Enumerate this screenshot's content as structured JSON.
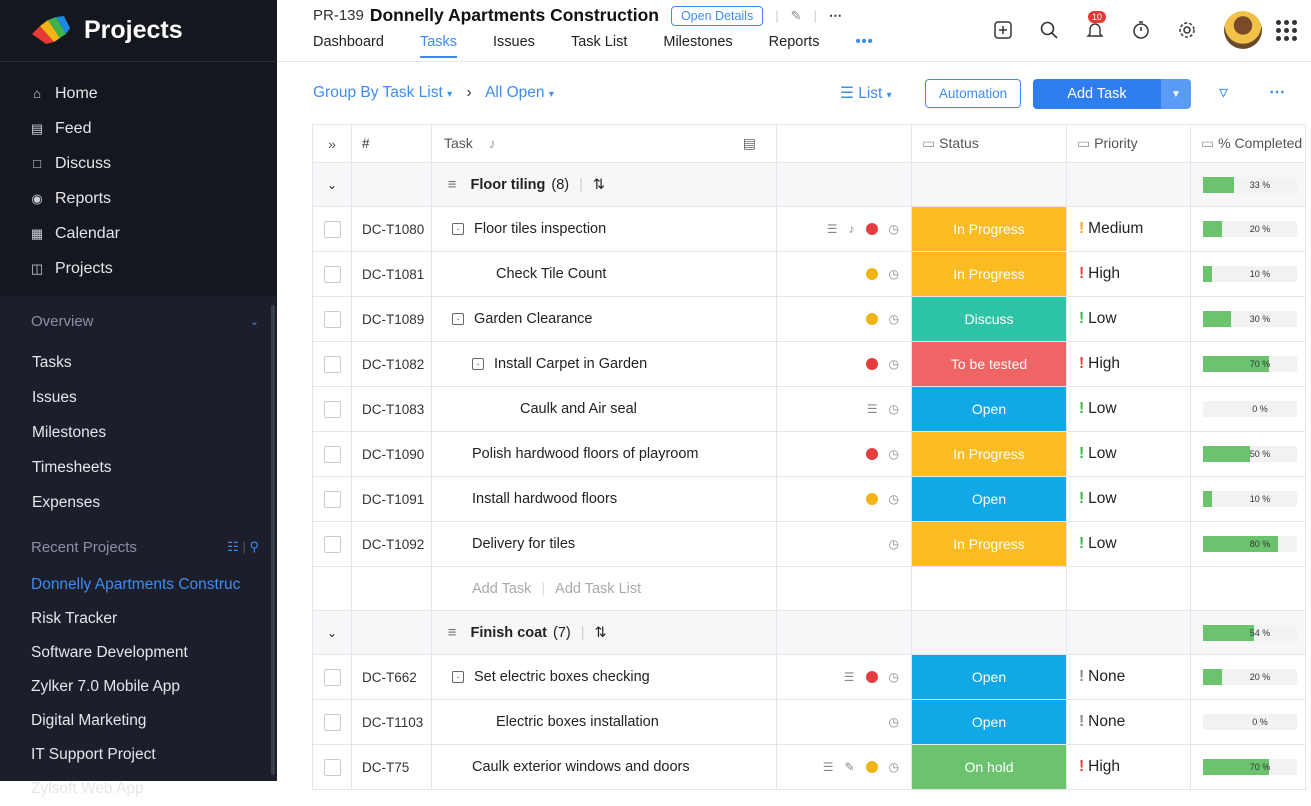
{
  "brand": {
    "name": "Projects"
  },
  "nav": [
    {
      "label": "Home",
      "icon": "home-icon"
    },
    {
      "label": "Feed",
      "icon": "feed-icon"
    },
    {
      "label": "Discuss",
      "icon": "discuss-icon"
    },
    {
      "label": "Reports",
      "icon": "reports-icon"
    },
    {
      "label": "Calendar",
      "icon": "calendar-icon"
    },
    {
      "label": "Projects",
      "icon": "projects-icon"
    }
  ],
  "overview": {
    "title": "Overview",
    "links": [
      "Tasks",
      "Issues",
      "Milestones",
      "Timesheets",
      "Expenses"
    ]
  },
  "recent": {
    "title": "Recent Projects",
    "items": [
      "Donnelly Apartments Construc",
      "Risk Tracker",
      "Software Development",
      "Zylker 7.0 Mobile App",
      "Digital Marketing",
      "IT Support Project",
      "Zylsoft Web App"
    ]
  },
  "header": {
    "project_id": "PR-139",
    "project_name": "Donnelly Apartments Construction",
    "open_details": "Open Details",
    "notification_count": "10",
    "tabs": [
      "Dashboard",
      "Tasks",
      "Issues",
      "Task List",
      "Milestones",
      "Reports"
    ],
    "more": "•••"
  },
  "toolbar": {
    "group_by": "Group By Task List",
    "filter": "All Open",
    "view": "List",
    "automation": "Automation",
    "add_task": "Add Task"
  },
  "columns": {
    "id": "#",
    "task": "Task",
    "status": "Status",
    "priority": "Priority",
    "complete": "% Completed"
  },
  "colors": {
    "accent": "#3f8cf0",
    "in_progress": "#fbbc23",
    "discuss": "#2ec4a7",
    "to_be_tested": "#ef6464",
    "open": "#10a8e6",
    "on_hold": "#6cc36e"
  },
  "groups": [
    {
      "name": "Floor tiling",
      "count": "(8)",
      "progress": "33 %",
      "pct": 33,
      "rows": [
        {
          "id": "DC-T1080",
          "name": "Floor tiles inspection",
          "level": "lv1e",
          "expand": true,
          "icons": [
            "comment",
            "bell"
          ],
          "dot": "r",
          "status": "In Progress",
          "scolor": "#fbbc23",
          "priority": "Medium",
          "pcls": "ex-y",
          "progress": "20 %",
          "pct": 20
        },
        {
          "id": "DC-T1081",
          "name": "Check Tile Count",
          "level": "lv2a",
          "expand": false,
          "icons": [],
          "dot": "y",
          "status": "In Progress",
          "scolor": "#fbbc23",
          "priority": "High",
          "pcls": "ex-r",
          "progress": "10 %",
          "pct": 10
        },
        {
          "id": "DC-T1089",
          "name": "Garden Clearance",
          "level": "lv1e",
          "expand": true,
          "icons": [],
          "dot": "y",
          "status": "Discuss",
          "scolor": "#2ec4a7",
          "priority": "Low",
          "pcls": "ex-g",
          "progress": "30 %",
          "pct": 30
        },
        {
          "id": "DC-T1082",
          "name": "Install Carpet in Garden",
          "level": "lv2e",
          "expand": true,
          "icons": [],
          "dot": "r",
          "status": "To be tested",
          "scolor": "#ef6464",
          "priority": "High",
          "pcls": "ex-r",
          "progress": "70 %",
          "pct": 70
        },
        {
          "id": "DC-T1083",
          "name": "Caulk and Air seal",
          "level": "lv3",
          "expand": false,
          "icons": [
            "comment"
          ],
          "dot": "",
          "status": "Open",
          "scolor": "#10a8e6",
          "priority": "Low",
          "pcls": "ex-g",
          "progress": "0 %",
          "pct": 0
        },
        {
          "id": "DC-T1090",
          "name": "Polish hardwood floors of playroom",
          "level": "lv1",
          "expand": false,
          "icons": [],
          "dot": "r",
          "status": "In Progress",
          "scolor": "#fbbc23",
          "priority": "Low",
          "pcls": "ex-g",
          "progress": "50 %",
          "pct": 50
        },
        {
          "id": "DC-T1091",
          "name": "Install hardwood floors",
          "level": "lv1",
          "expand": false,
          "icons": [],
          "dot": "y",
          "status": "Open",
          "scolor": "#10a8e6",
          "priority": "Low",
          "pcls": "ex-g",
          "progress": "10 %",
          "pct": 10
        },
        {
          "id": "DC-T1092",
          "name": "Delivery for tiles",
          "level": "lv1",
          "expand": false,
          "icons": [],
          "dot": "",
          "status": "In Progress",
          "scolor": "#fbbc23",
          "priority": "Low",
          "pcls": "ex-g",
          "progress": "80 %",
          "pct": 80
        }
      ]
    },
    {
      "name": "Finish coat",
      "count": "(7)",
      "progress": "54 %",
      "pct": 54,
      "rows": [
        {
          "id": "DC-T662",
          "name": "Set electric boxes checking",
          "level": "lv1e",
          "expand": true,
          "icons": [
            "comment"
          ],
          "dot": "r",
          "status": "Open",
          "scolor": "#10a8e6",
          "priority": "None",
          "pcls": "ex-n",
          "progress": "20 %",
          "pct": 20
        },
        {
          "id": "DC-T1103",
          "name": "Electric boxes installation",
          "level": "lv2a",
          "expand": false,
          "icons": [],
          "dot": "",
          "status": "Open",
          "scolor": "#10a8e6",
          "priority": "None",
          "pcls": "ex-n",
          "progress": "0 %",
          "pct": 0
        },
        {
          "id": "DC-T75",
          "name": "Caulk exterior windows and doors",
          "level": "lv1",
          "expand": false,
          "icons": [
            "comment",
            "tag"
          ],
          "dot": "y",
          "status": "On hold",
          "scolor": "#6cc36e",
          "priority": "High",
          "pcls": "ex-r",
          "progress": "70 %",
          "pct": 70
        }
      ]
    }
  ],
  "add_row": {
    "add_task": "Add Task",
    "add_task_list": "Add Task List"
  }
}
